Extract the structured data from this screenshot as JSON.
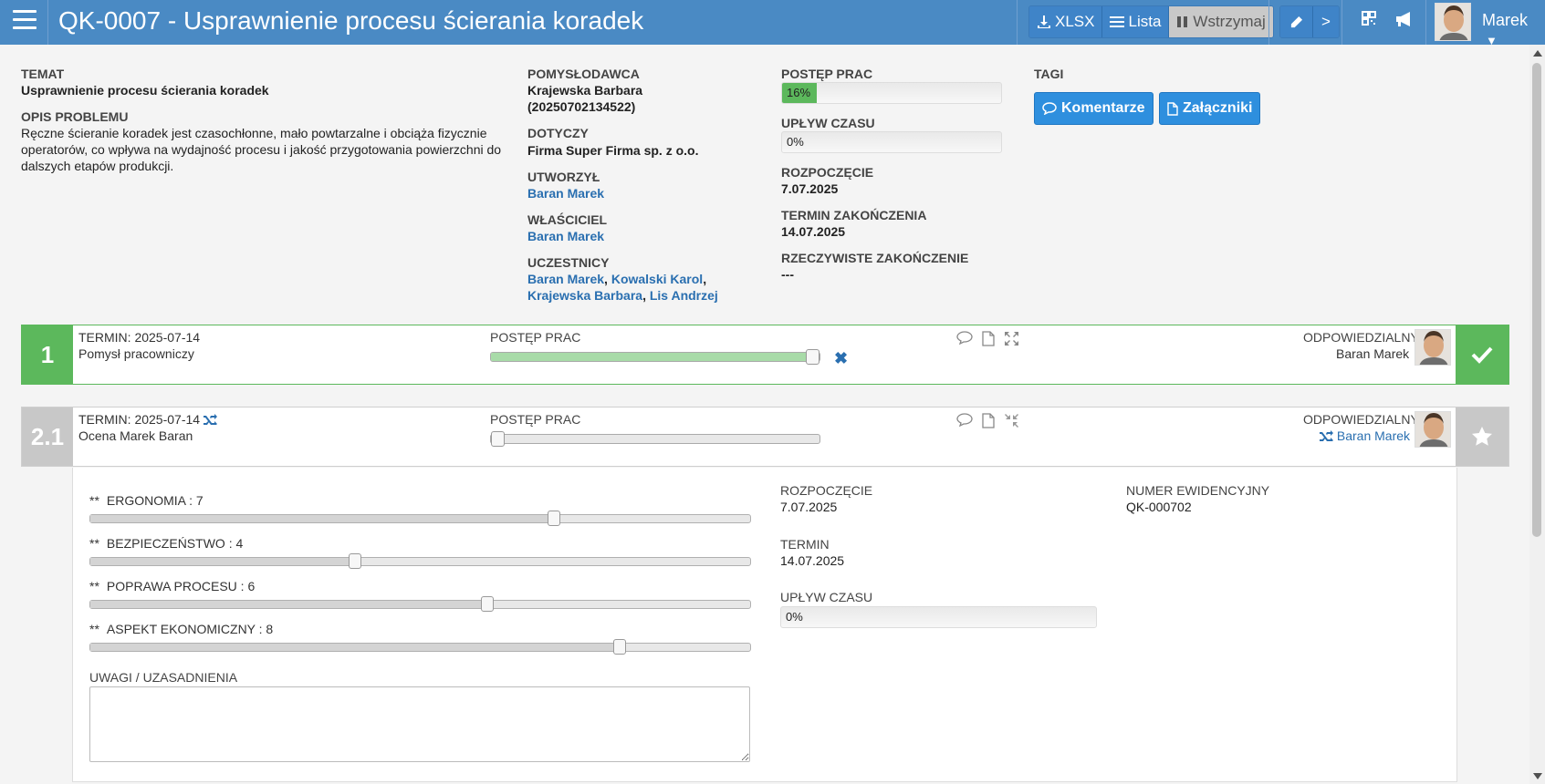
{
  "header": {
    "title": "QK-0007 - Usprawnienie procesu ścierania koradek",
    "buttons": {
      "xlsx": "XLSX",
      "list": "Lista",
      "pause": "Wstrzymaj",
      "next": ">"
    },
    "user_name": "Marek"
  },
  "info": {
    "topic_label": "TEMAT",
    "topic": "Usprawnienie procesu ścierania koradek",
    "problem_label": "OPIS PROBLEMU",
    "problem": "Ręczne ścieranie koradek jest czasochłonne, mało powtarzalne i obciąża fizycznie operatorów, co wpływa na wydajność procesu i jakość przygotowania powierzchni do dalszych etapów produkcji.",
    "author_label": "POMYSŁODAWCA",
    "author_name": "Krajewska Barbara",
    "author_id": "(20250702134522)",
    "concerns_label": "DOTYCZY",
    "concerns": "Firma Super Firma sp. z o.o.",
    "created_label": "UTWORZYŁ",
    "created_by": "Baran Marek",
    "owner_label": "WŁAŚCICIEL",
    "owner": "Baran Marek",
    "participants_label": "UCZESTNICY",
    "participants": [
      "Baran Marek",
      "Kowalski Karol",
      "Krajewska Barbara",
      "Lis Andrzej"
    ],
    "progress_label": "POSTĘP PRAC",
    "progress_text": "16%",
    "progress_value": 16,
    "time_label": "UPŁYW CZASU",
    "time_text": "0%",
    "start_label": "ROZPOCZĘCIE",
    "start": "7.07.2025",
    "deadline_label": "TERMIN ZAKOŃCZENIA",
    "deadline": "14.07.2025",
    "actual_end_label": "RZECZYWISTE ZAKOŃCZENIE",
    "actual_end": "---",
    "tags_label": "TAGI",
    "comments_btn": "Komentarze",
    "attachments_btn": "Załączniki"
  },
  "stages": [
    {
      "number": "1",
      "term": "TERMIN: 2025-07-14",
      "name": "Pomysł pracowniczy",
      "progress_label": "POSTĘP PRAC",
      "progress_value": 100,
      "responsible_label": "ODPOWIEDZIALNY",
      "responsible": "Baran Marek"
    },
    {
      "number": "2.1",
      "term": "TERMIN: 2025-07-14",
      "name": "Ocena Marek Baran",
      "progress_label": "POSTĘP PRAC",
      "progress_value": 0,
      "responsible_label": "ODPOWIEDZIALNY",
      "responsible": "Baran Marek"
    }
  ],
  "detail": {
    "criteria": [
      {
        "prefix": "**",
        "label": "ERGONOMIA : 7",
        "value": 7
      },
      {
        "prefix": "**",
        "label": "BEZPIECZEŃSTWO : 4",
        "value": 4
      },
      {
        "prefix": "**",
        "label": "POPRAWA PROCESU : 6",
        "value": 6
      },
      {
        "prefix": "**",
        "label": "ASPEKT EKONOMICZNY : 8",
        "value": 8
      }
    ],
    "criteria_max": 10,
    "notes_label": "UWAGI / UZASADNIENIA",
    "notes_value": "",
    "start_label": "ROZPOCZĘCIE",
    "start": "7.07.2025",
    "term_label": "TERMIN",
    "term": "14.07.2025",
    "time_label": "UPŁYW CZASU",
    "time_text": "0%",
    "reg_label": "NUMER EWIDENCYJNY",
    "reg_number": "QK-000702"
  },
  "colors": {
    "header": "#4a8ac4",
    "success": "#5cb85c",
    "link": "#2a6fb0",
    "button": "#2e8fde"
  },
  "icons": [
    "menu-icon",
    "download-icon",
    "list-icon",
    "pause-icon",
    "pencil-icon",
    "qr-icon",
    "megaphone-icon",
    "comment-icon",
    "file-icon",
    "expand-icon",
    "compress-icon",
    "shuffle-icon",
    "check-icon",
    "star-icon",
    "close-icon"
  ]
}
